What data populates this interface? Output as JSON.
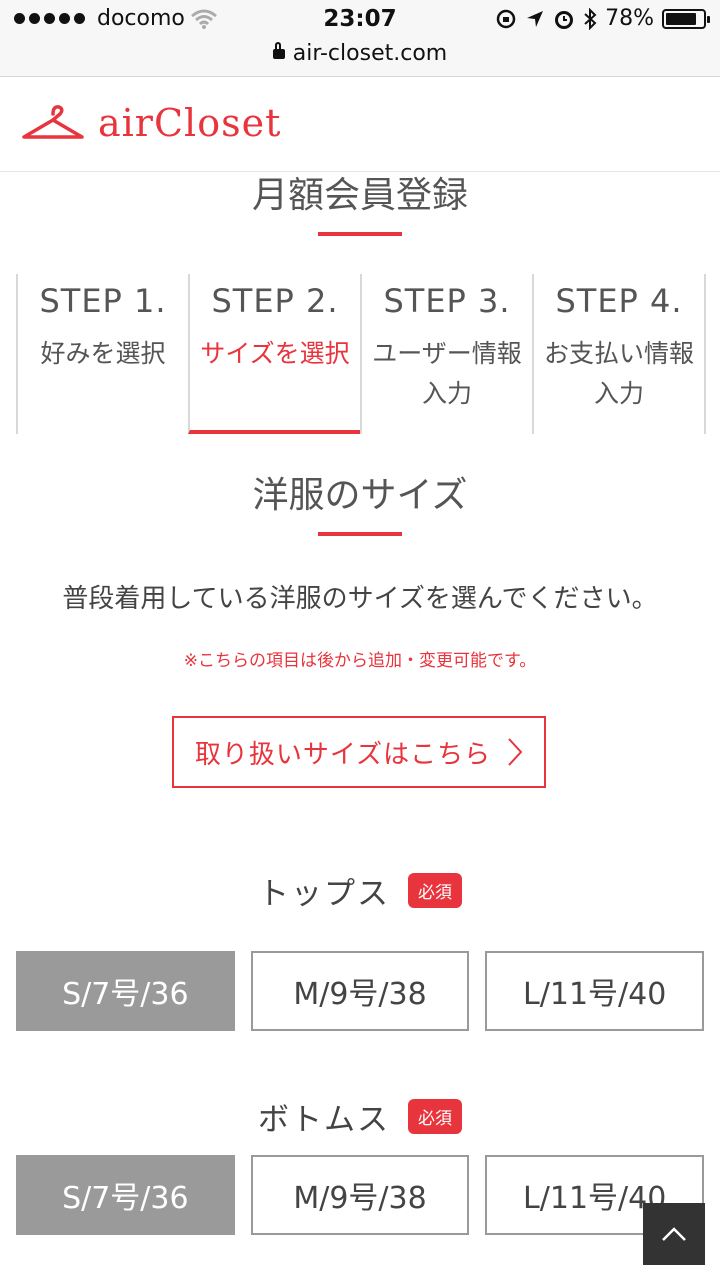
{
  "status_bar": {
    "carrier": "docomo",
    "time": "23:07",
    "battery": "78%",
    "battery_level": 0.78
  },
  "browser": {
    "url": "air-closet.com"
  },
  "header": {
    "logo_text": "airCloset"
  },
  "page": {
    "title": "月額会員登録",
    "steps": [
      {
        "num": "STEP 1.",
        "label": "好みを選択",
        "active": false
      },
      {
        "num": "STEP 2.",
        "label": "サイズを選択",
        "active": true
      },
      {
        "num": "STEP 3.",
        "label": "ユーザー情報入力",
        "active": false
      },
      {
        "num": "STEP 4.",
        "label": "お支払い情報入力",
        "active": false
      }
    ],
    "section_title": "洋服のサイズ",
    "description": "普段着用している洋服のサイズを選んでください。",
    "note": "※こちらの項目は後から追加・変更可能です。",
    "size_link_label": "取り扱いサイズはこちら",
    "required_badge": "必須",
    "tops": {
      "label": "トップス",
      "options": [
        "S/7号/36",
        "M/9号/38",
        "L/11号/40"
      ],
      "selected": 0
    },
    "bottoms": {
      "label": "ボトムス",
      "options": [
        "S/7号/36",
        "M/9号/38",
        "L/11号/40"
      ],
      "selected": 0
    }
  },
  "colors": {
    "accent": "#e8343c",
    "selected": "#9a9a9a",
    "scroll_top_bg": "#333333"
  },
  "icons": {
    "lock": "lock-icon",
    "hanger": "hanger-icon",
    "chevron": "chevron-right-icon",
    "scroll_top": "chevron-up-icon"
  }
}
